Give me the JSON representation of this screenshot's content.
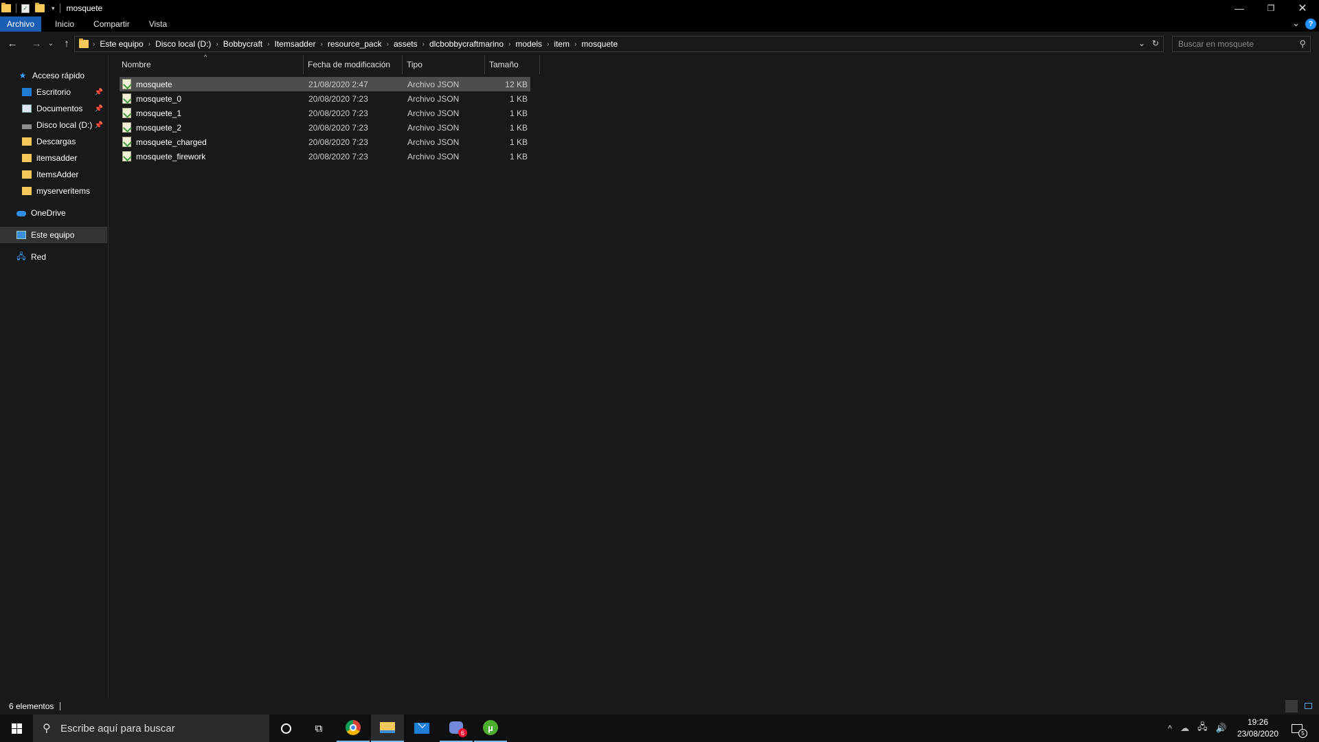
{
  "window": {
    "title": "mosquete"
  },
  "ribbon": {
    "tabs": [
      "Archivo",
      "Inicio",
      "Compartir",
      "Vista"
    ],
    "help": "?"
  },
  "address": {
    "crumbs": [
      "Este equipo",
      "Disco local (D:)",
      "Bobbycraft",
      "Itemsadder",
      "resource_pack",
      "assets",
      "dlcbobbycraftmarino",
      "models",
      "item",
      "mosquete"
    ]
  },
  "search": {
    "placeholder": "Buscar en mosquete"
  },
  "navpane": {
    "quick_access": "Acceso rápido",
    "items": [
      "Escritorio",
      "Documentos",
      "Disco local (D:)",
      "Descargas",
      "itemsadder",
      "ItemsAdder",
      "myserveritems"
    ],
    "onedrive": "OneDrive",
    "this_pc": "Este equipo",
    "network": "Red"
  },
  "columns": {
    "name": "Nombre",
    "date": "Fecha de modificación",
    "type": "Tipo",
    "size": "Tamaño"
  },
  "files": [
    {
      "name": "mosquete",
      "date": "21/08/2020 2:47",
      "type": "Archivo JSON",
      "size": "12 KB"
    },
    {
      "name": "mosquete_0",
      "date": "20/08/2020 7:23",
      "type": "Archivo JSON",
      "size": "1 KB"
    },
    {
      "name": "mosquete_1",
      "date": "20/08/2020 7:23",
      "type": "Archivo JSON",
      "size": "1 KB"
    },
    {
      "name": "mosquete_2",
      "date": "20/08/2020 7:23",
      "type": "Archivo JSON",
      "size": "1 KB"
    },
    {
      "name": "mosquete_charged",
      "date": "20/08/2020 7:23",
      "type": "Archivo JSON",
      "size": "1 KB"
    },
    {
      "name": "mosquete_firework",
      "date": "20/08/2020 7:23",
      "type": "Archivo JSON",
      "size": "1 KB"
    }
  ],
  "status": {
    "count": "6 elementos"
  },
  "taskbar": {
    "search_placeholder": "Escribe aquí para buscar",
    "time": "19:26",
    "date": "23/08/2020",
    "notifications": "5",
    "discord_badge": "6"
  },
  "colors": {
    "accent": "#1a5fb4",
    "selection": "#4d4d4d",
    "background": "#191919"
  }
}
